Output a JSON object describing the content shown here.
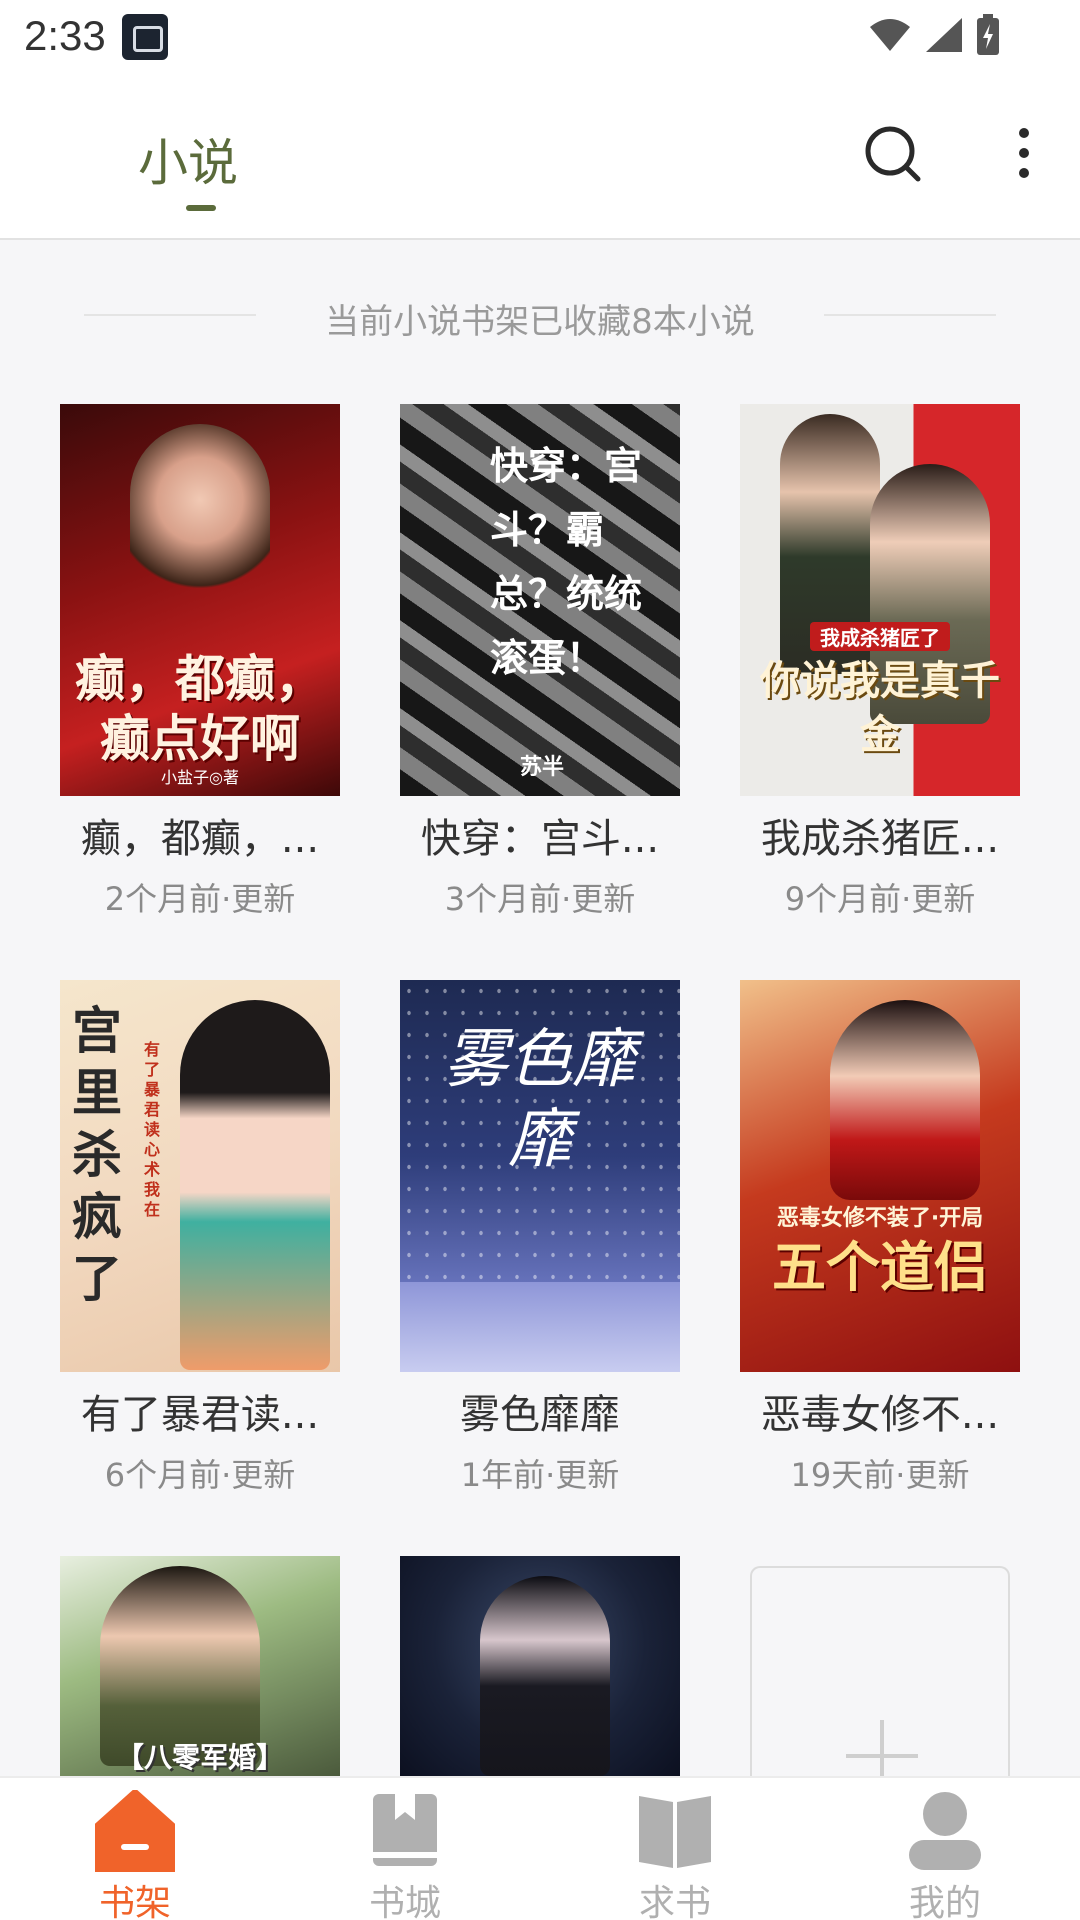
{
  "status_bar": {
    "time": "2:33"
  },
  "header": {
    "tab_label": "小说"
  },
  "shelf": {
    "info_text": "当前小说书架已收藏8本小说"
  },
  "books": [
    {
      "cover_text": "癫，都癫，癫点好啊",
      "cover_author": "小盐子◎著",
      "title": "癫，都癫，...",
      "meta": "2个月前·更新"
    },
    {
      "cover_text": "快穿：宫斗？霸总？统统滚蛋！",
      "cover_author": "苏半",
      "title": "快穿：宫斗...",
      "meta": "3个月前·更新"
    },
    {
      "cover_text": "你说我是真千金",
      "cover_author": "我成杀猪匠了",
      "title": "我成杀猪匠...",
      "meta": "9个月前·更新"
    },
    {
      "cover_text": "宫里杀疯了",
      "cover_author": "有了暴君读心术我在",
      "title": "有了暴君读...",
      "meta": "6个月前·更新"
    },
    {
      "cover_text": "雾色靡靡",
      "cover_author": "",
      "title": "雾色靡靡",
      "meta": "1年前·更新"
    },
    {
      "cover_text": "五个道侣",
      "cover_author": "恶毒女修不装了·开局",
      "title": "恶毒女修不...",
      "meta": "19天前·更新"
    },
    {
      "cover_text": "【八零军婚】",
      "cover_author": "",
      "title": "",
      "meta": ""
    },
    {
      "cover_text": "",
      "cover_author": "",
      "title": "",
      "meta": ""
    }
  ],
  "bottom_nav": [
    {
      "label": "书架",
      "active": true,
      "icon": "bookshelf-icon"
    },
    {
      "label": "书城",
      "active": false,
      "icon": "book-icon"
    },
    {
      "label": "求书",
      "active": false,
      "icon": "open-book-icon"
    },
    {
      "label": "我的",
      "active": false,
      "icon": "profile-icon"
    }
  ],
  "colors": {
    "accent": "#5b6b3b",
    "nav_active": "#f0632a",
    "nav_inactive": "#b0b0b0"
  }
}
